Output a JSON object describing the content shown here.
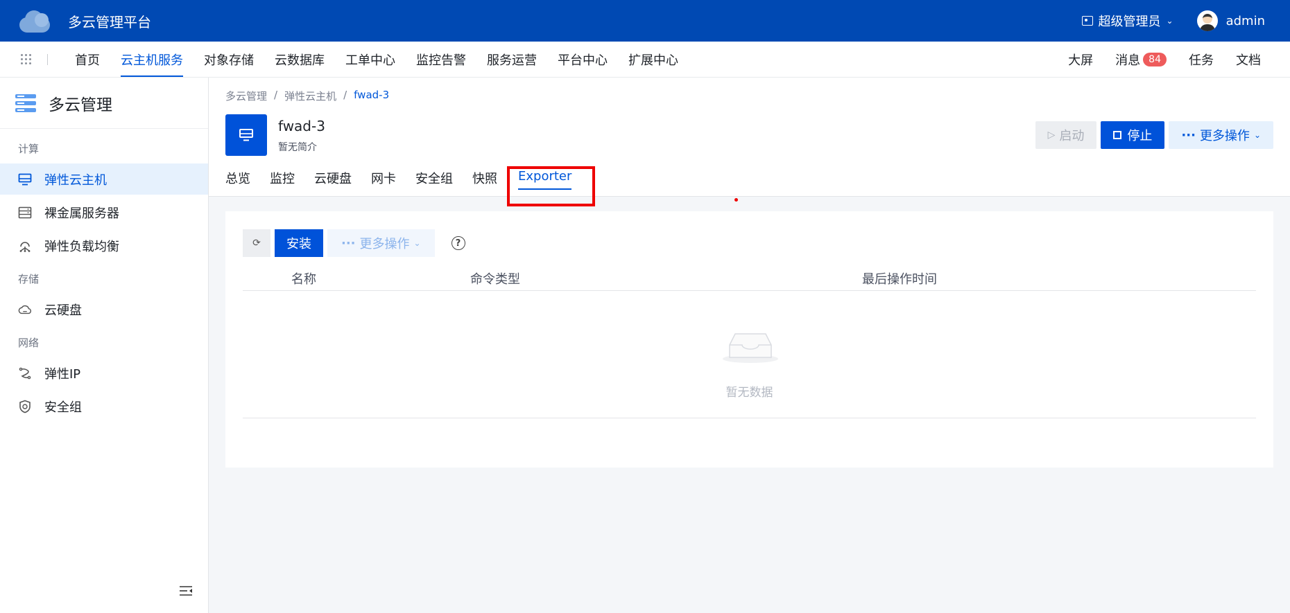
{
  "app": {
    "title": "多云管理平台"
  },
  "topbar": {
    "role": "超级管理员",
    "user": "admin"
  },
  "nav": {
    "items": [
      "首页",
      "云主机服务",
      "对象存储",
      "云数据库",
      "工单中心",
      "监控告警",
      "服务运营",
      "平台中心",
      "扩展中心"
    ],
    "active_index": 1,
    "right": {
      "screen": "大屏",
      "messages": "消息",
      "message_count": "84",
      "tasks": "任务",
      "docs": "文档"
    }
  },
  "sidebar": {
    "title": "多云管理",
    "groups": [
      {
        "label": "计算",
        "items": [
          {
            "label": "弹性云主机",
            "icon": "monitor-icon",
            "active": true
          },
          {
            "label": "裸金属服务器",
            "icon": "server-icon"
          },
          {
            "label": "弹性负载均衡",
            "icon": "load-balancer-icon"
          }
        ]
      },
      {
        "label": "存储",
        "items": [
          {
            "label": "云硬盘",
            "icon": "cloud-disk-icon"
          }
        ]
      },
      {
        "label": "网络",
        "items": [
          {
            "label": "弹性IP",
            "icon": "elastic-ip-icon"
          },
          {
            "label": "安全组",
            "icon": "shield-icon"
          }
        ]
      }
    ]
  },
  "breadcrumb": [
    "多云管理",
    "弹性云主机",
    "fwad-3"
  ],
  "resource": {
    "name": "fwad-3",
    "description": "暂无简介"
  },
  "actions": {
    "start": "启动",
    "stop": "停止",
    "more": "更多操作"
  },
  "tabs": [
    "总览",
    "监控",
    "云硬盘",
    "网卡",
    "安全组",
    "快照",
    "Exporter"
  ],
  "active_tab": "Exporter",
  "toolbar": {
    "install": "安装",
    "more": "更多操作"
  },
  "table": {
    "columns": [
      "名称",
      "命令类型",
      "最后操作时间"
    ],
    "rows": [],
    "empty_text": "暂无数据"
  }
}
